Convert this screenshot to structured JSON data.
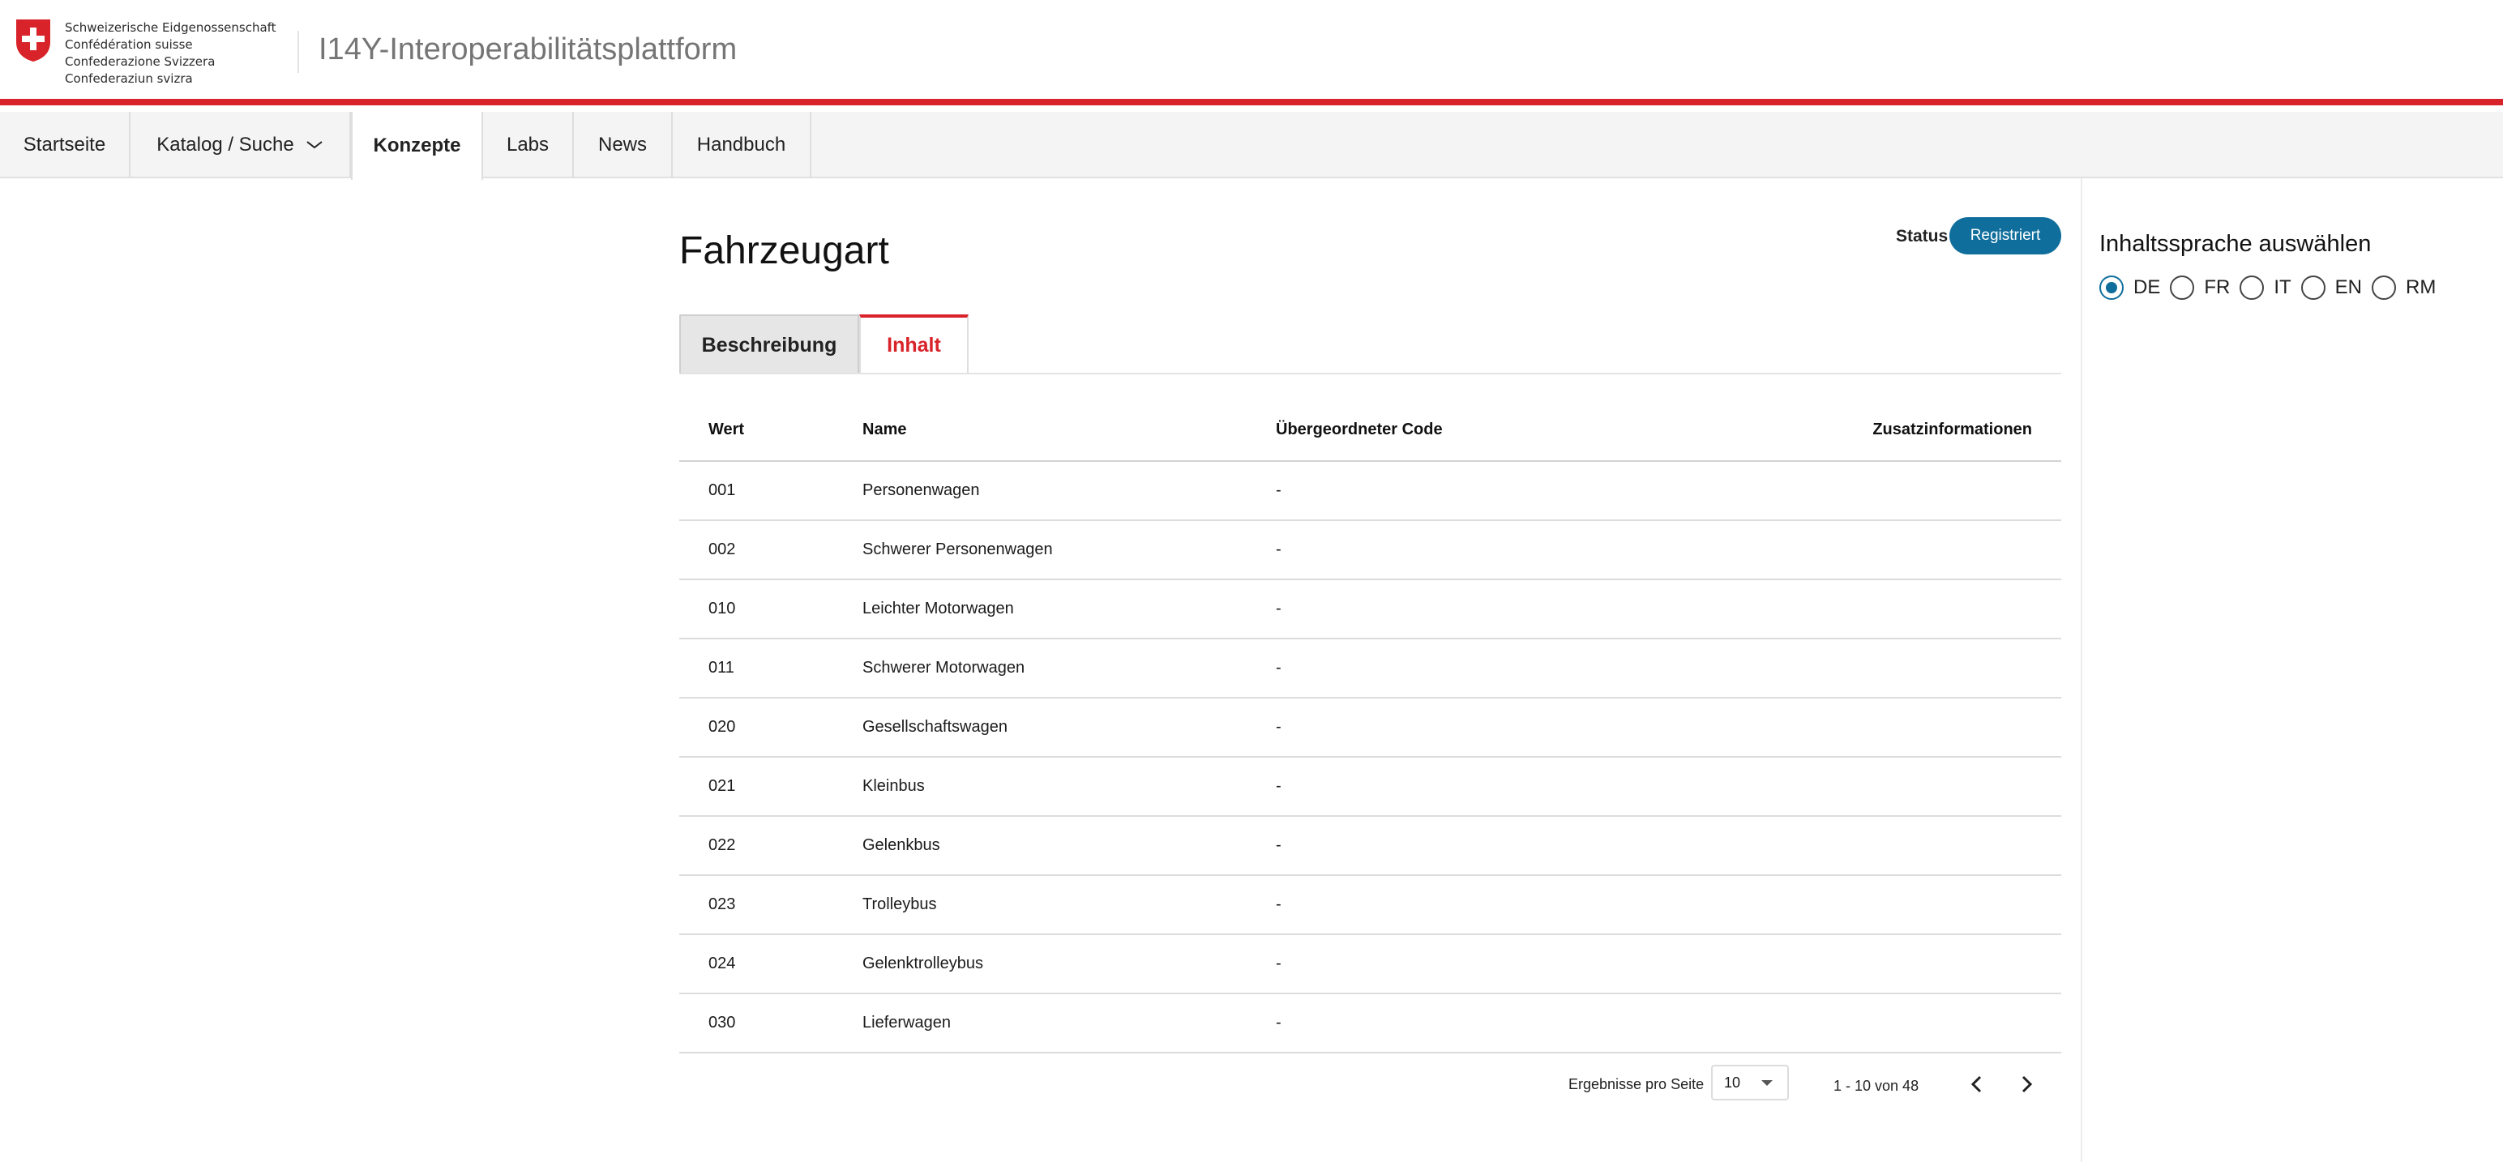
{
  "header": {
    "federation_lines": [
      "Schweizerische Eidgenossenschaft",
      "Confédération suisse",
      "Confederazione Svizzera",
      "Confederaziun svizra"
    ],
    "platform_title": "I14Y-Interoperabilitätsplattform"
  },
  "nav": {
    "items": [
      {
        "label": "Startseite"
      },
      {
        "label": "Katalog / Suche"
      },
      {
        "label": "Konzepte"
      },
      {
        "label": "Labs"
      },
      {
        "label": "News"
      },
      {
        "label": "Handbuch"
      }
    ],
    "active": "Konzepte"
  },
  "main": {
    "title": "Fahrzeugart",
    "status_label": "Status",
    "status_value": "Registriert",
    "tabs": [
      {
        "label": "Beschreibung"
      },
      {
        "label": "Inhalt"
      }
    ],
    "active_tab": "Inhalt",
    "table": {
      "columns": [
        "Wert",
        "Name",
        "Übergeordneter Code",
        "Zusatzinformationen"
      ],
      "rows": [
        {
          "wert": "001",
          "name": "Personenwagen",
          "parent": "-",
          "extra": ""
        },
        {
          "wert": "002",
          "name": "Schwerer Personenwagen",
          "parent": "-",
          "extra": ""
        },
        {
          "wert": "010",
          "name": "Leichter Motorwagen",
          "parent": "-",
          "extra": ""
        },
        {
          "wert": "011",
          "name": "Schwerer Motorwagen",
          "parent": "-",
          "extra": ""
        },
        {
          "wert": "020",
          "name": "Gesellschaftswagen",
          "parent": "-",
          "extra": ""
        },
        {
          "wert": "021",
          "name": "Kleinbus",
          "parent": "-",
          "extra": ""
        },
        {
          "wert": "022",
          "name": "Gelenkbus",
          "parent": "-",
          "extra": ""
        },
        {
          "wert": "023",
          "name": "Trolleybus",
          "parent": "-",
          "extra": ""
        },
        {
          "wert": "024",
          "name": "Gelenktrolleybus",
          "parent": "-",
          "extra": ""
        },
        {
          "wert": "030",
          "name": "Lieferwagen",
          "parent": "-",
          "extra": ""
        }
      ]
    },
    "pagination": {
      "per_page_label": "Ergebnisse pro Seite",
      "per_page_value": "10",
      "range_text": "1 - 10 von 48"
    }
  },
  "language_panel": {
    "title": "Inhaltssprache auswählen",
    "options": [
      "DE",
      "FR",
      "IT",
      "EN",
      "RM"
    ],
    "selected": "DE"
  },
  "colors": {
    "swiss_red": "#d8232a",
    "status_blue": "#0f6e9c"
  },
  "icons": {
    "logo": "swiss-cross-shield-icon",
    "nav_dropdown": "chevron-down-icon",
    "prev": "chevron-left-icon",
    "next": "chevron-right-icon",
    "select_caret": "caret-down-icon"
  }
}
